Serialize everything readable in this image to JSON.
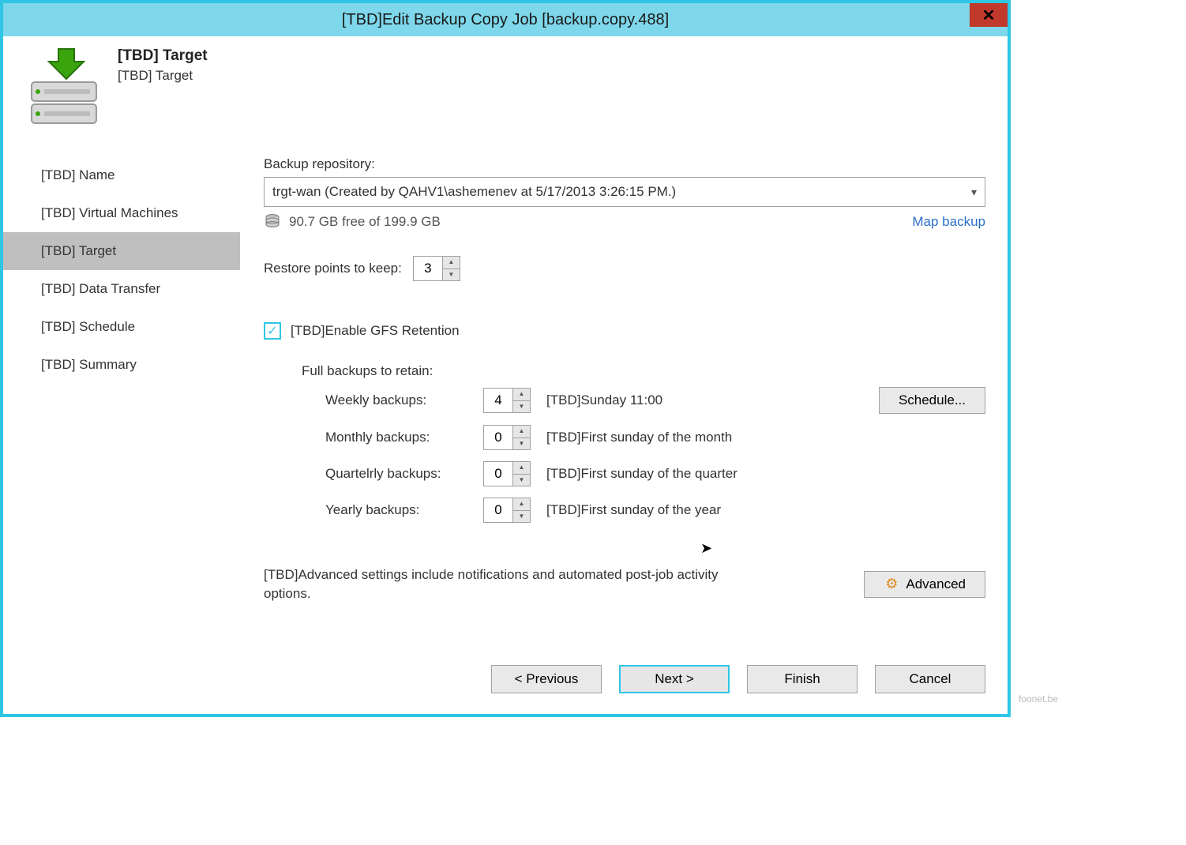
{
  "window": {
    "title": "[TBD]Edit Backup Copy Job [backup.copy.488]"
  },
  "header": {
    "title": "[TBD] Target",
    "subtitle": "[TBD] Target"
  },
  "nav": {
    "items": [
      {
        "label": "[TBD] Name"
      },
      {
        "label": "[TBD] Virtual Machines"
      },
      {
        "label": "[TBD] Target"
      },
      {
        "label": "[TBD] Data Transfer"
      },
      {
        "label": "[TBD] Schedule"
      },
      {
        "label": "[TBD] Summary"
      }
    ],
    "active_index": 2
  },
  "content": {
    "repo_label": "Backup repository:",
    "repo_value": "trgt-wan (Created by QAHV1\\ashemenev at 5/17/2013 3:26:15 PM.)",
    "free_space": "90.7 GB free of 199.9 GB",
    "map_backup": "Map backup",
    "restore_label": "Restore points to keep:",
    "restore_value": "3",
    "gfs_checkbox_label": "[TBD]Enable GFS Retention",
    "gfs_checked": true,
    "retain_title": "Full backups to retain:",
    "retain_rows": [
      {
        "label": "Weekly backups:",
        "value": "4",
        "desc": "[TBD]Sunday 11:00"
      },
      {
        "label": "Monthly backups:",
        "value": "0",
        "desc": "[TBD]First sunday of the month"
      },
      {
        "label": "Quartelrly backups:",
        "value": "0",
        "desc": "[TBD]First sunday of the quarter"
      },
      {
        "label": "Yearly backups:",
        "value": "0",
        "desc": "[TBD]First sunday of the year"
      }
    ],
    "schedule_button": "Schedule...",
    "advanced_text": "[TBD]Advanced settings include notifications and automated post-job activity options.",
    "advanced_button": "Advanced"
  },
  "footer": {
    "previous": "< Previous",
    "next": "Next >",
    "finish": "Finish",
    "cancel": "Cancel"
  },
  "watermark": "foonet.be"
}
